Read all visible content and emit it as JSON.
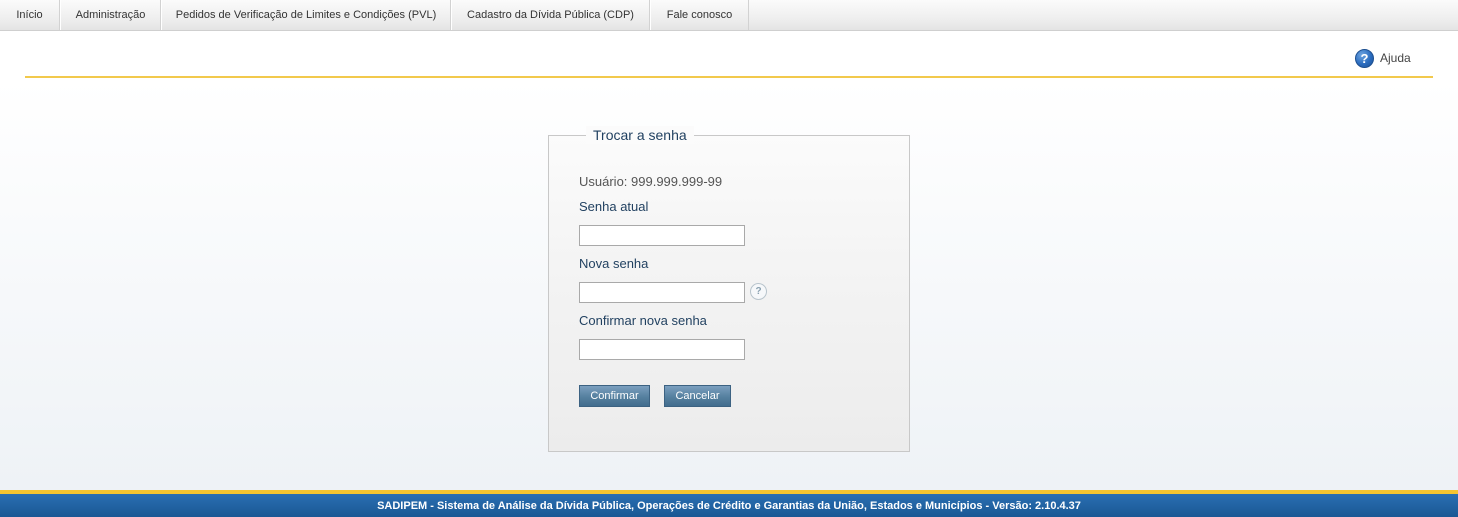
{
  "nav": {
    "items": [
      {
        "label": "Início"
      },
      {
        "label": "Administração"
      },
      {
        "label": "Pedidos de Verificação de Limites e Condições (PVL)"
      },
      {
        "label": "Cadastro da Dívida Pública (CDP)"
      },
      {
        "label": "Fale conosco"
      }
    ]
  },
  "help": {
    "icon": "question-circle-icon",
    "label": "Ajuda"
  },
  "form": {
    "title": "Trocar a senha",
    "usuario_text": "Usuário: 999.999.999-99",
    "current_password_label": "Senha atual",
    "current_password_value": "",
    "new_password_label": "Nova senha",
    "new_password_value": "",
    "new_password_help_icon": "question-icon",
    "confirm_password_label": "Confirmar nova senha",
    "confirm_password_value": "",
    "confirm_button": "Confirmar",
    "cancel_button": "Cancelar"
  },
  "footer": {
    "text": "SADIPEM - Sistema de Análise da Dívida Pública, Operações de Crédito e Garantias da União, Estados e Municípios - Versão: 2.10.4.37"
  },
  "colors": {
    "accent_yellow": "#f2c94c",
    "footer_blue": "#1a5793",
    "button_blue": "#55809f",
    "label_dark_blue": "#1f3f5f"
  }
}
